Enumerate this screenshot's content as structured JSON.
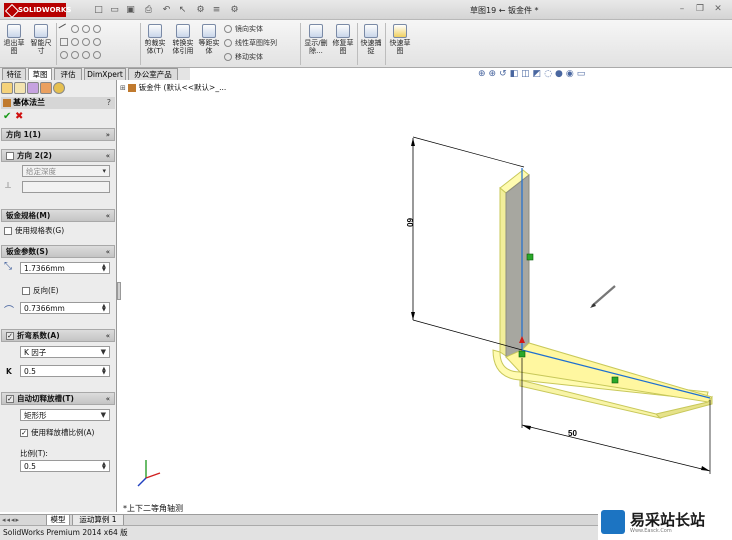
{
  "app": {
    "logo_text": "SOLIDWORKS",
    "document_title": "草图19 ← 钣金件 *",
    "status_text": "SolidWorks Premium 2014 x64 版"
  },
  "ribbon": {
    "buttons": [
      {
        "label": "退出草图"
      },
      {
        "label": "智能尺寸"
      },
      {
        "label": "剪裁实体(T)"
      },
      {
        "label": "转换实体引用"
      },
      {
        "label": "等距实体"
      },
      {
        "label": "显示/删除..."
      },
      {
        "label": "修复草图"
      },
      {
        "label": "快速捕捉"
      },
      {
        "label": "快速草图"
      }
    ],
    "small_rows": [
      {
        "label": "镜向实体"
      },
      {
        "label": "线性草图阵列"
      },
      {
        "label": "移动实体"
      }
    ]
  },
  "tabs": [
    {
      "label": "特征",
      "active": false
    },
    {
      "label": "草图",
      "active": true
    },
    {
      "label": "评估",
      "active": false
    },
    {
      "label": "DimXpert",
      "active": false
    },
    {
      "label": "办公室产品",
      "active": false
    }
  ],
  "property_manager": {
    "title": "基体法兰",
    "ok_icon": "check-icon",
    "cancel_icon": "x-icon",
    "direction1": {
      "header": "方向 1(1)"
    },
    "direction2": {
      "header": "方向 2(2)",
      "end_condition": "给定深度"
    },
    "gauge": {
      "header": "钣金规格(M)",
      "use_table_label": "使用规格表(G)"
    },
    "params": {
      "header": "钣金参数(S)",
      "thickness": "1.7366mm",
      "reverse_label": "反向(E)",
      "bend_radius": "0.7366mm"
    },
    "bend_allowance": {
      "header": "折弯系数(A)",
      "type": "K 因子",
      "k_label": "K",
      "k_value": "0.5"
    },
    "relief": {
      "header": "自动切释放槽(T)",
      "type": "矩形形",
      "use_ratio_label": "使用释放槽比例(A)",
      "ratio_label": "比例(T):",
      "ratio_value": "0.5"
    }
  },
  "tree": {
    "root_label": "钣金件 (默认<<默认>_..."
  },
  "viewport": {
    "view_name": "*上下二等角轴测",
    "dimension_vertical": "60",
    "dimension_horizontal": "50",
    "sketch_color": "#1e6fd0",
    "body_fill": "#fffbb0",
    "body_stroke": "#c8c85a"
  },
  "bottom_tabs": [
    {
      "label": "模型"
    },
    {
      "label": "运动算例 1"
    }
  ],
  "watermark": {
    "text": "易采站长站",
    "sub": "Www.Easck.Com"
  }
}
